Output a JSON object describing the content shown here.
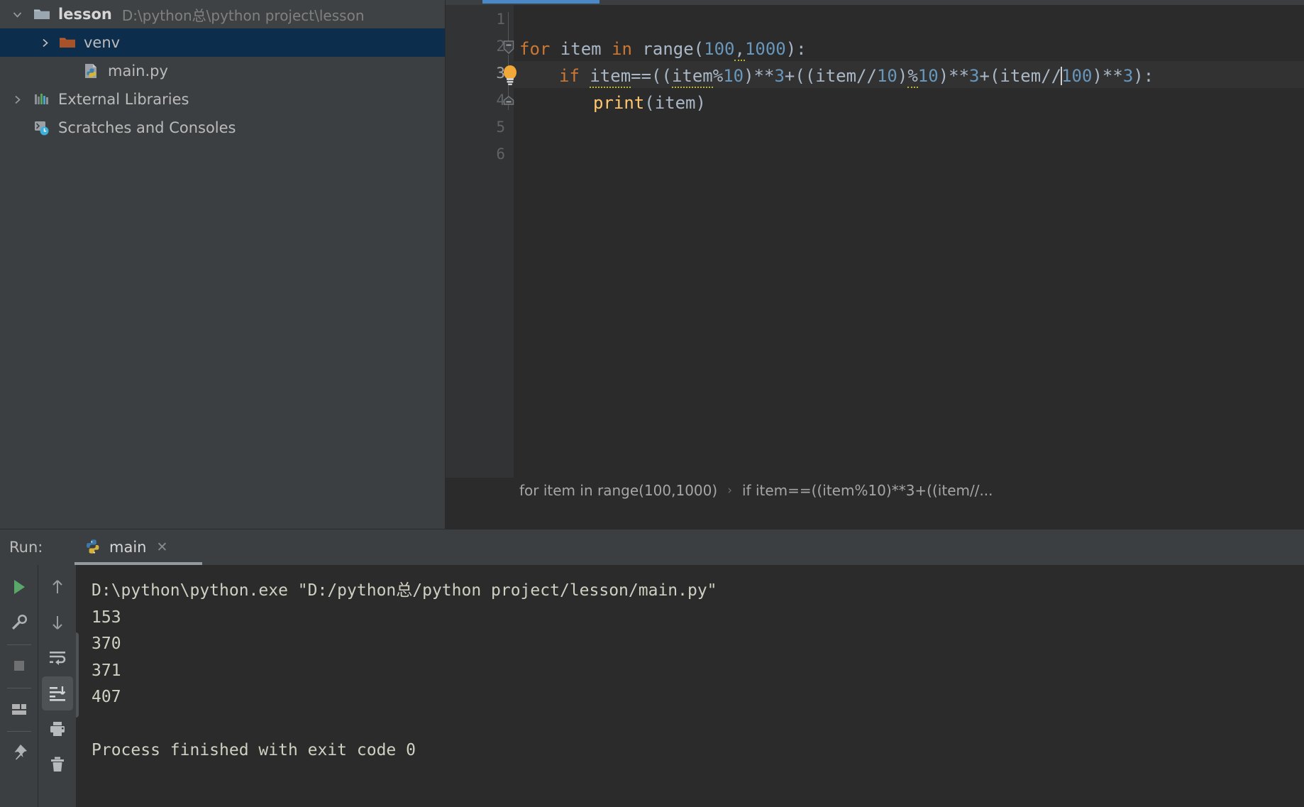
{
  "project": {
    "root": {
      "name": "lesson",
      "path": "D:\\python总\\python project\\lesson",
      "icon": "folder-icon",
      "expanded": true
    },
    "items": [
      {
        "label": "venv",
        "icon": "folder-orange-icon",
        "selected": true,
        "expandable": true,
        "level": 1
      },
      {
        "label": "main.py",
        "icon": "python-file-icon",
        "selected": false,
        "expandable": false,
        "level": 2
      },
      {
        "label": "External Libraries",
        "icon": "libraries-icon",
        "selected": false,
        "expandable": true,
        "level": 0
      },
      {
        "label": "Scratches and Consoles",
        "icon": "scratches-icon",
        "selected": false,
        "expandable": false,
        "level": 0
      }
    ]
  },
  "editor": {
    "line_numbers": [
      "1",
      "2",
      "3",
      "4",
      "5",
      "6"
    ],
    "current_line": 3,
    "lines": [
      {
        "n": 1,
        "text": ""
      },
      {
        "n": 2,
        "text": "for item in range(100,1000):"
      },
      {
        "n": 3,
        "text": "    if item==((item%10)**3+((item//10)%10)**3+(item//100)**3):"
      },
      {
        "n": 4,
        "text": "        print(item)"
      },
      {
        "n": 5,
        "text": ""
      },
      {
        "n": 6,
        "text": ""
      }
    ],
    "caret_line": 3,
    "intention_icon": "lightbulb-icon",
    "fold_lines": [
      2,
      4
    ],
    "breadcrumbs": [
      "for item in range(100,1000)",
      "if item==((item%10)**3+((item//..."
    ],
    "breadcrumb_separator": "›",
    "colors": {
      "keyword": "#cc7832",
      "number": "#6897bb",
      "function": "#ffc66d",
      "text": "#a9b7c6",
      "background": "#2b2b2b"
    }
  },
  "run": {
    "label": "Run:",
    "tab_name": "main",
    "tab_icon": "python-icon",
    "close_icon": "close-icon",
    "toolbar_left": [
      "run-icon",
      "settings-wrench-icon",
      "stop-icon",
      "layout-icon",
      "pin-icon"
    ],
    "toolbar_right": [
      "up-arrow-icon",
      "down-arrow-icon",
      "soft-wrap-icon",
      "scroll-to-end-icon",
      "print-icon",
      "trash-icon"
    ],
    "active_tool": "scroll-to-end-icon",
    "console_lines": [
      "D:\\python\\python.exe \"D:/python总/python project/lesson/main.py\"",
      "153",
      "370",
      "371",
      "407",
      "",
      "Process finished with exit code 0"
    ]
  }
}
